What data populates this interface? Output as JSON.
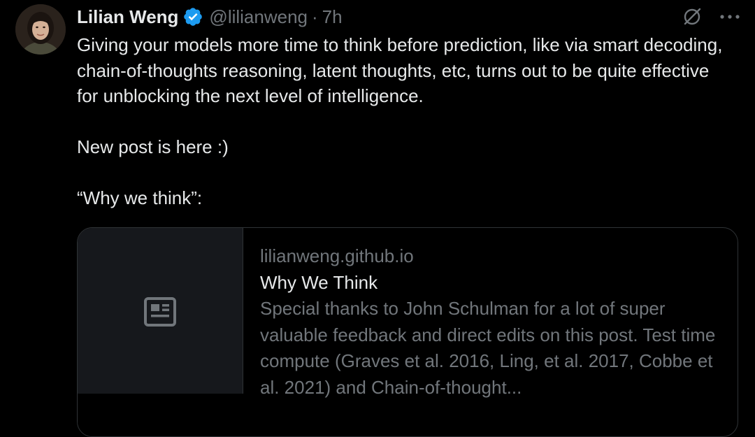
{
  "author": {
    "display_name": "Lilian Weng",
    "handle": "@lilianweng",
    "separator": "·",
    "time": "7h",
    "verified_icon": "verified-badge-icon"
  },
  "header_actions": {
    "grok_icon": "grok-icon",
    "more_icon": "more-horizontal-icon"
  },
  "tweet": {
    "line1": "Giving your models more time to think before prediction, like via smart decoding, chain-of-thoughts reasoning, latent thoughts, etc, turns out to be quite effective for unblocking the next level of intelligence.",
    "line2": "New post is here :)",
    "line3": "“Why we think”:"
  },
  "link_card": {
    "domain": "lilianweng.github.io",
    "title": "Why We Think",
    "description": "Special thanks to John Schulman for a lot of super valuable feedback and direct edits on this post. Test time compute (Graves et al. 2016, Ling, et al. 2017, Cobbe et al. 2021) and Chain-of-thought...",
    "thumbnail_icon": "article-placeholder-icon"
  },
  "colors": {
    "background": "#000000",
    "text_primary": "#e7e9ea",
    "text_secondary": "#71767b",
    "verified": "#1d9bf0",
    "border": "#2f3336"
  }
}
